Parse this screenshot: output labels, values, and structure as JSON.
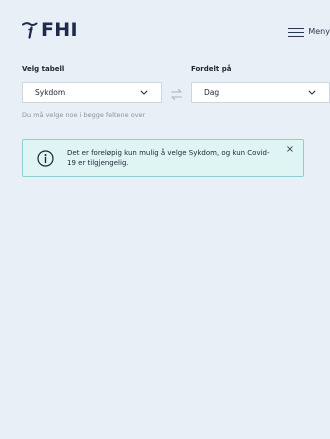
{
  "header": {
    "logo_text": "FHI",
    "menu_label": "Meny"
  },
  "form": {
    "table_label": "Velg tabell",
    "table_value": "Sykdom",
    "group_label": "Fordelt på",
    "group_value": "Dag",
    "helper_text": "Du må velge noe i begge feltene over"
  },
  "alert": {
    "message": "Det er foreløpig kun mulig å velge Sykdom, og kun Covid-19 er tilgjengelig.",
    "close_symbol": "×"
  },
  "colors": {
    "page_background": "#e9eff7",
    "alert_background": "#dff5f4",
    "alert_border": "#8ccfcf",
    "brand_navy": "#1e2a4a"
  },
  "icons": {
    "logo": "fhi-logo-icon",
    "menu": "hamburger-icon",
    "select_arrow": "chevron-down-icon",
    "swap": "swap-arrows-icon",
    "info": "info-icon",
    "close": "close-icon"
  }
}
